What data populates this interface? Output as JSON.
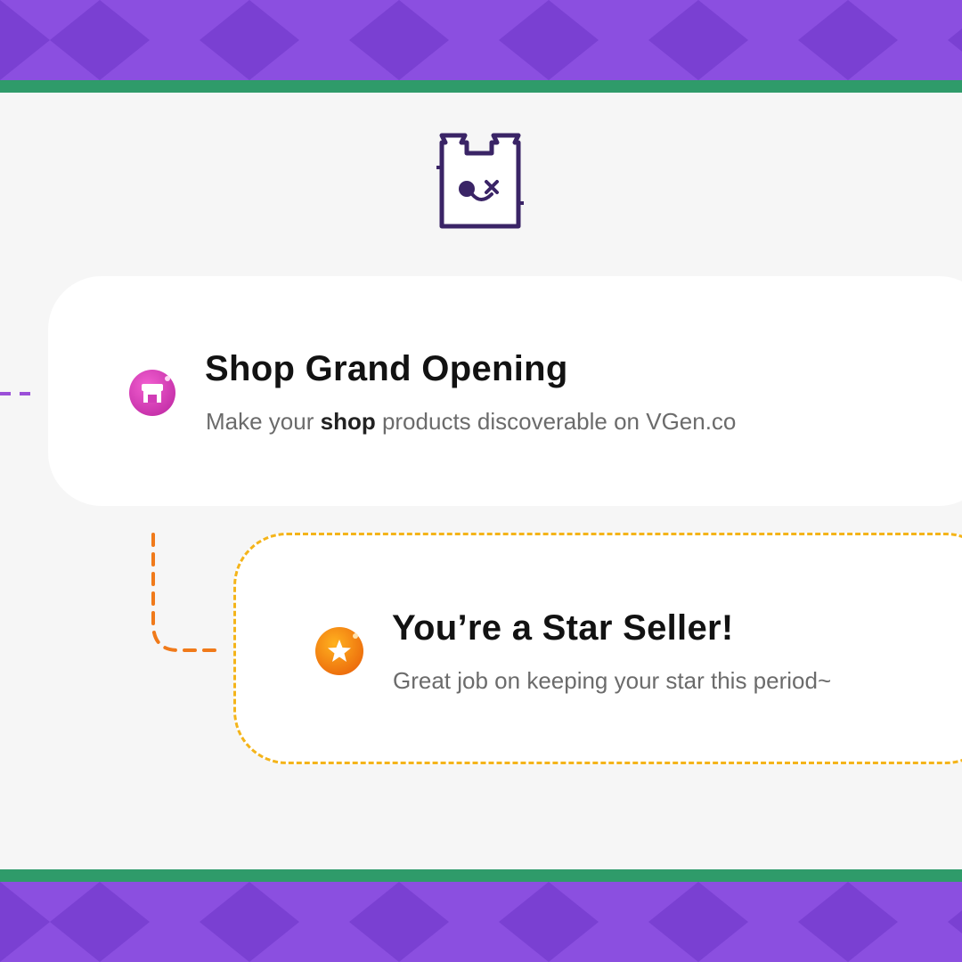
{
  "colors": {
    "band_purple": "#8b4fe0",
    "stripe_green": "#2f9b6a",
    "background": "#f6f6f6",
    "accent_orange": "#f4b41a",
    "shop_pink": "#e040b8",
    "star_orange": "#f07a10"
  },
  "icons": {
    "mascot": "mascot-logo-icon",
    "shop": "shop-storefront-icon",
    "star": "star-badge-icon"
  },
  "milestones": [
    {
      "title": "Shop Grand Opening",
      "subtitle_prefix": "Make your ",
      "subtitle_bold": "shop",
      "subtitle_suffix": " products discoverable on VGen.co"
    },
    {
      "title": "You’re a Star Seller!",
      "subtitle": "Great job on keeping your star this period~"
    }
  ]
}
